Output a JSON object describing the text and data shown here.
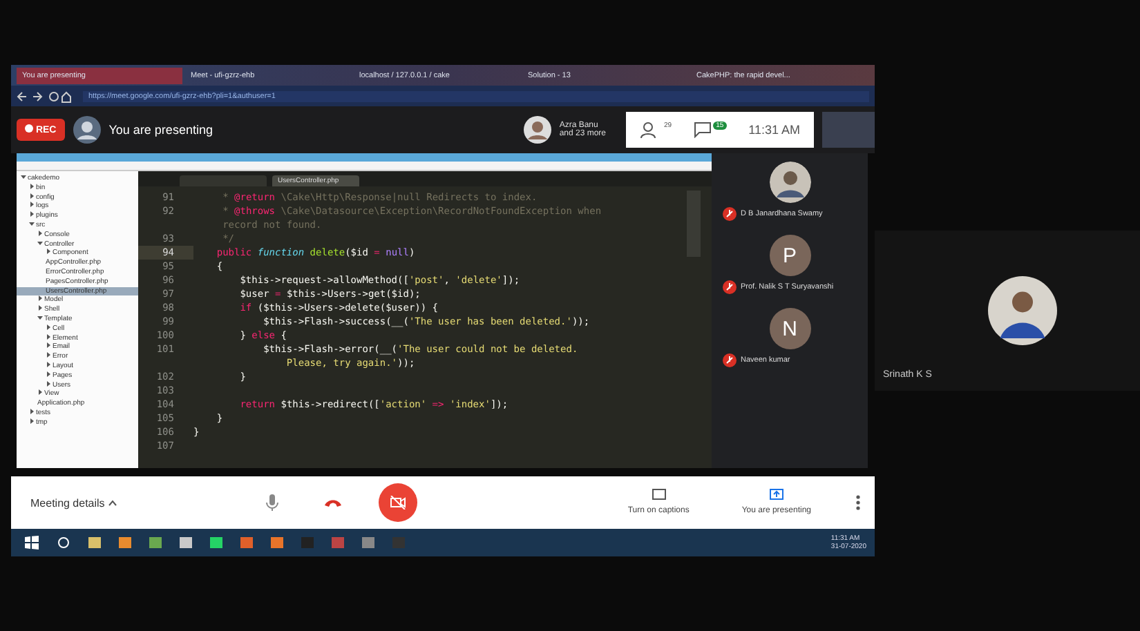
{
  "browser": {
    "tabs": [
      {
        "title": "You are presenting",
        "selected": true
      },
      {
        "title": "Meet - ufi-gzrz-ehb",
        "selected": false
      },
      {
        "title": "localhost / 127.0.0.1 / cake",
        "selected": false
      },
      {
        "title": "Solution - 13",
        "selected": false
      },
      {
        "title": "CakePHP: the rapid devel...",
        "selected": false
      }
    ],
    "url": "https://meet.google.com/ufi-gzrz-ehb?pli=1&authuser=1"
  },
  "meet_bar": {
    "rec": "REC",
    "status": "You are presenting",
    "viewer_name": "Azra Banu",
    "viewer_more": "and 23 more",
    "people_count": "29",
    "chat_count": "15",
    "time": "11:31 AM"
  },
  "ide": {
    "tree": [
      {
        "name": "cakedemo",
        "expanded": true,
        "selected": false,
        "children": [
          {
            "name": "bin",
            "expanded": false,
            "selected": false
          },
          {
            "name": "config",
            "expanded": false,
            "selected": false
          },
          {
            "name": "logs",
            "expanded": false,
            "selected": false
          },
          {
            "name": "plugins",
            "expanded": false,
            "selected": false
          },
          {
            "name": "src",
            "expanded": true,
            "selected": false,
            "children": [
              {
                "name": "Console",
                "expanded": false,
                "selected": false
              },
              {
                "name": "Controller",
                "expanded": true,
                "selected": false,
                "children": [
                  {
                    "name": "Component",
                    "expanded": false,
                    "selected": false
                  },
                  {
                    "name": "AppController.php",
                    "selected": false
                  },
                  {
                    "name": "ErrorController.php",
                    "selected": false
                  },
                  {
                    "name": "PagesController.php",
                    "selected": false
                  },
                  {
                    "name": "UsersController.php",
                    "selected": true
                  }
                ]
              },
              {
                "name": "Model",
                "expanded": false,
                "selected": false
              },
              {
                "name": "Shell",
                "expanded": false,
                "selected": false
              },
              {
                "name": "Template",
                "expanded": true,
                "selected": false,
                "children": [
                  {
                    "name": "Cell",
                    "expanded": false,
                    "selected": false
                  },
                  {
                    "name": "Element",
                    "expanded": false,
                    "selected": false
                  },
                  {
                    "name": "Email",
                    "expanded": false,
                    "selected": false
                  },
                  {
                    "name": "Error",
                    "expanded": false,
                    "selected": false
                  },
                  {
                    "name": "Layout",
                    "expanded": false,
                    "selected": false
                  },
                  {
                    "name": "Pages",
                    "expanded": false,
                    "selected": false
                  },
                  {
                    "name": "Users",
                    "expanded": false,
                    "selected": false
                  }
                ]
              },
              {
                "name": "View",
                "expanded": false,
                "selected": false
              },
              {
                "name": "Application.php",
                "selected": false
              }
            ]
          },
          {
            "name": "tests",
            "expanded": false,
            "selected": false
          },
          {
            "name": "tmp",
            "expanded": false,
            "selected": false
          }
        ]
      }
    ],
    "editor_tabs": [
      {
        "title": "UsersController.php",
        "selected": true
      }
    ],
    "lines": [
      {
        "number": "91",
        "current": false,
        "segments": [
          {
            "kind": "comment",
            "text": "     * "
          },
          {
            "kind": "tag",
            "text": "@return"
          },
          {
            "kind": "comment",
            "text": " \\Cake\\Http\\Response|null Redirects to index."
          }
        ]
      },
      {
        "number": "92",
        "current": false,
        "segments": [
          {
            "kind": "comment",
            "text": "     * "
          },
          {
            "kind": "tag",
            "text": "@throws"
          },
          {
            "kind": "comment",
            "text": " \\Cake\\Datasource\\Exception\\RecordNotFoundException when"
          }
        ]
      },
      {
        "segments": [
          {
            "kind": "comment",
            "text": "     record not found."
          }
        ]
      },
      {
        "number": "93",
        "current": false,
        "segments": [
          {
            "kind": "comment",
            "text": "     */"
          }
        ]
      },
      {
        "number": "94",
        "current": true,
        "segments": [
          {
            "kind": "keyword",
            "text": "    public "
          },
          {
            "kind": "storage",
            "text": "function "
          },
          {
            "kind": "func",
            "text": "delete"
          },
          {
            "kind": "plain",
            "text": "($id "
          },
          {
            "kind": "op",
            "text": "= "
          },
          {
            "kind": "constant",
            "text": "null"
          },
          {
            "kind": "plain",
            "text": ")"
          }
        ]
      },
      {
        "number": "95",
        "current": false,
        "segments": [
          {
            "kind": "plain",
            "text": "    {"
          }
        ]
      },
      {
        "number": "96",
        "current": false,
        "segments": [
          {
            "kind": "plain",
            "text": "        $this->request->allowMethod(["
          },
          {
            "kind": "string",
            "text": "'post'"
          },
          {
            "kind": "plain",
            "text": ", "
          },
          {
            "kind": "string",
            "text": "'delete'"
          },
          {
            "kind": "plain",
            "text": "]);"
          }
        ]
      },
      {
        "number": "97",
        "current": false,
        "segments": [
          {
            "kind": "plain",
            "text": "        $user "
          },
          {
            "kind": "op",
            "text": "="
          },
          {
            "kind": "plain",
            "text": " $this->Users->get($id);"
          }
        ]
      },
      {
        "number": "98",
        "current": false,
        "segments": [
          {
            "kind": "keyword",
            "text": "        if"
          },
          {
            "kind": "plain",
            "text": " ($this->Users->delete($user)) {"
          }
        ]
      },
      {
        "number": "99",
        "current": false,
        "segments": [
          {
            "kind": "plain",
            "text": "            $this->Flash->success(__("
          },
          {
            "kind": "string",
            "text": "'The user has been deleted.'"
          },
          {
            "kind": "plain",
            "text": "));"
          }
        ]
      },
      {
        "number": "100",
        "current": false,
        "segments": [
          {
            "kind": "plain",
            "text": "        } "
          },
          {
            "kind": "keyword",
            "text": "else"
          },
          {
            "kind": "plain",
            "text": " {"
          }
        ]
      },
      {
        "number": "101",
        "current": false,
        "segments": [
          {
            "kind": "plain",
            "text": "            $this->Flash->error(__("
          },
          {
            "kind": "string",
            "text": "'The user could not be deleted."
          }
        ]
      },
      {
        "segments": [
          {
            "kind": "string",
            "text": "                Please, try again.'"
          },
          {
            "kind": "plain",
            "text": "));"
          }
        ]
      },
      {
        "number": "102",
        "current": false,
        "segments": [
          {
            "kind": "plain",
            "text": "        }"
          }
        ]
      },
      {
        "number": "103",
        "current": false
      },
      {
        "number": "104",
        "current": false,
        "segments": [
          {
            "kind": "keyword",
            "text": "        return"
          },
          {
            "kind": "plain",
            "text": " $this->redirect(["
          },
          {
            "kind": "string",
            "text": "'action'"
          },
          {
            "kind": "op",
            "text": " => "
          },
          {
            "kind": "string",
            "text": "'index'"
          },
          {
            "kind": "plain",
            "text": "]);"
          }
        ]
      },
      {
        "number": "105",
        "current": false,
        "segments": [
          {
            "kind": "plain",
            "text": "    }"
          }
        ]
      },
      {
        "number": "106",
        "current": false,
        "segments": [
          {
            "kind": "plain",
            "text": "}"
          }
        ]
      },
      {
        "number": "107",
        "current": false
      }
    ]
  },
  "participants": [
    {
      "name": "D B Janardhana Swamy",
      "kind": "photo",
      "muted": true
    },
    {
      "name": "Prof. Nalik S T Suryavanshi",
      "kind": "letter",
      "letter": "P",
      "muted": true
    },
    {
      "name": "Naveen kumar",
      "kind": "letter",
      "letter": "N",
      "muted": true
    }
  ],
  "main_tile": {
    "name": "Srinath K S"
  },
  "bottom_bar": {
    "details": "Meeting details",
    "captions": "Turn on captions",
    "presenting": "You are presenting"
  },
  "taskbar": {
    "time": "11:31 AM",
    "date": "31-07-2020"
  }
}
